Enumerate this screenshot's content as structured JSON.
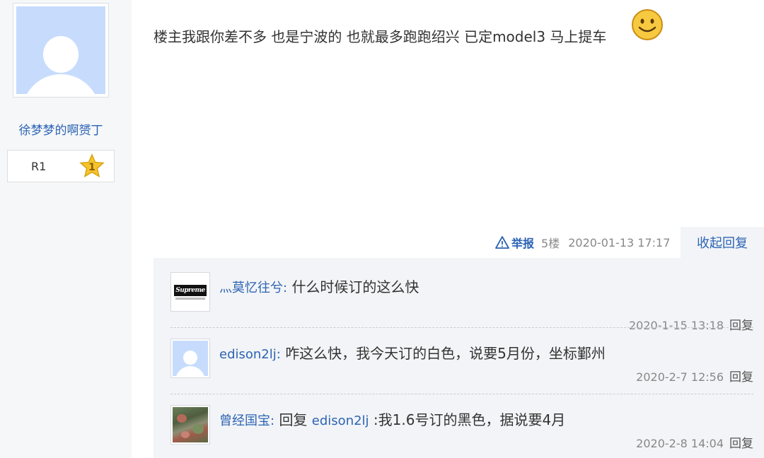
{
  "author": {
    "name": "徐梦梦的啊赟丁",
    "level": "R1",
    "level_badge": "1"
  },
  "post": {
    "text": "楼主我跟你差不多 也是宁波的 也就最多跑跑绍兴 已定model3 马上提车",
    "emoji": "smiley-face",
    "report_label": "举报",
    "floor": "5楼",
    "datetime": "2020-01-13 17:17",
    "collapse_label": "收起回复"
  },
  "replies": [
    {
      "user": "灬莫忆往兮:",
      "text": "什么时候订的这么快",
      "time": "2020-1-15 13:18",
      "reply_label": "回复",
      "avatar_text": "Supreme"
    },
    {
      "user": "edison2lj:",
      "text": "咋这么快，我今天订的白色，说要5月份，坐标鄞州",
      "time": "2020-2-7 12:56",
      "reply_label": "回复"
    },
    {
      "user": "曾经国宝:",
      "reply_word": "回复",
      "mention": "edison2lj",
      "text": ":我1.6号订的黑色，据说要4月",
      "time": "2020-2-8 14:04",
      "reply_label": "回复"
    }
  ],
  "colors": {
    "link": "#2d64b3",
    "meta_gray": "#888888",
    "reply_bg": "#f2f4f7",
    "avatar_blue": "#c7dcfd"
  }
}
